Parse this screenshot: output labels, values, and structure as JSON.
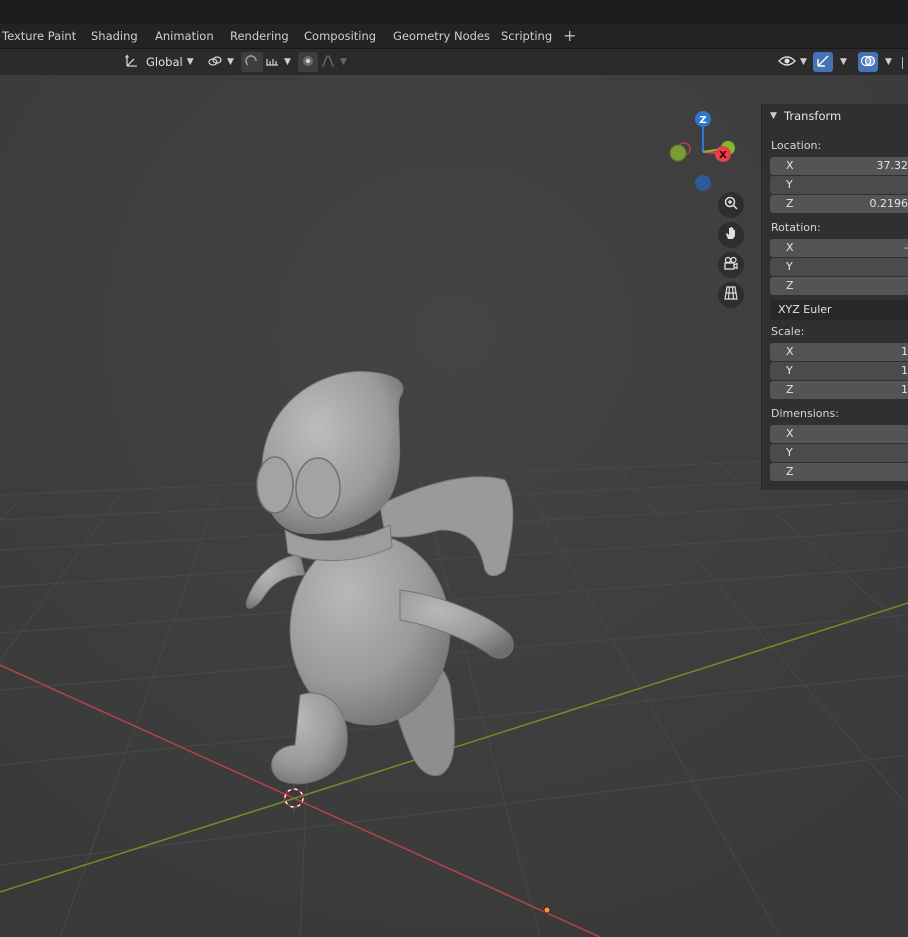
{
  "workspace_tabs": [
    "Texture Paint",
    "Shading",
    "Animation",
    "Rendering",
    "Compositing",
    "Geometry Nodes",
    "Scripting"
  ],
  "add_tab_label": "+",
  "header": {
    "orientation_label": "Global"
  },
  "gizmo": {
    "z_label": "Z",
    "x_label": "X"
  },
  "nav_buttons": [
    "zoom-icon",
    "hand-pan-icon",
    "camera-icon",
    "grid-ortho-icon"
  ],
  "transform_panel": {
    "title": "Transform",
    "location": {
      "label": "Location:",
      "x": {
        "axis": "X",
        "value": "37.32"
      },
      "y": {
        "axis": "Y",
        "value": ""
      },
      "z": {
        "axis": "Z",
        "value": "0.2196"
      }
    },
    "rotation": {
      "label": "Rotation:",
      "x": {
        "axis": "X",
        "value": "-"
      },
      "y": {
        "axis": "Y",
        "value": ""
      },
      "z": {
        "axis": "Z",
        "value": ""
      },
      "mode": "XYZ Euler"
    },
    "scale": {
      "label": "Scale:",
      "x": {
        "axis": "X",
        "value": "1"
      },
      "y": {
        "axis": "Y",
        "value": "1"
      },
      "z": {
        "axis": "Z",
        "value": "1"
      }
    },
    "dimensions": {
      "label": "Dimensions:",
      "x": {
        "axis": "X",
        "value": ""
      },
      "y": {
        "axis": "Y",
        "value": ""
      },
      "z": {
        "axis": "Z",
        "value": ""
      }
    }
  },
  "colors": {
    "x_axis": "#e8414e",
    "y_axis": "#85b82f",
    "z_axis": "#2f76cf",
    "accent": "#4772b3"
  }
}
